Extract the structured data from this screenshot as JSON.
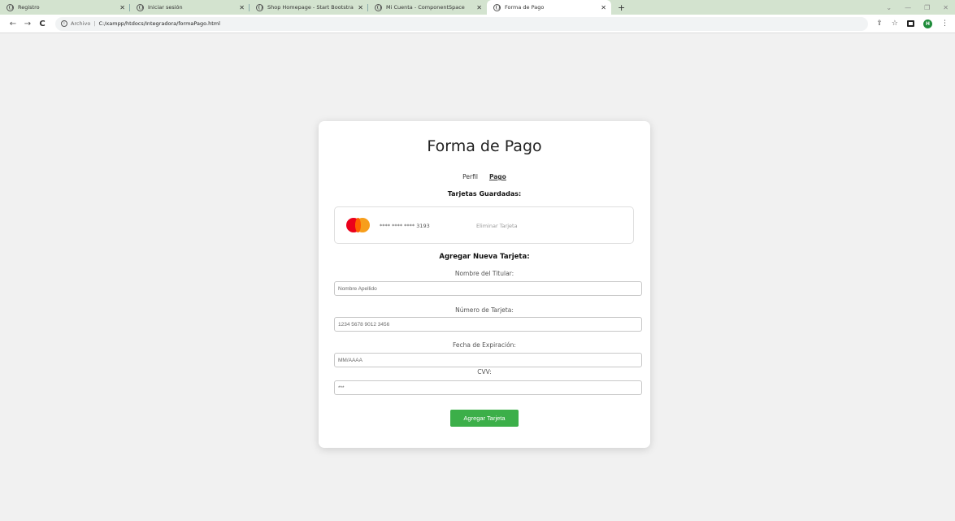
{
  "browser": {
    "tabs": [
      {
        "label": "Registro",
        "active": false
      },
      {
        "label": "Iniciar sesión",
        "active": false
      },
      {
        "label": "Shop Homepage - Start Bootstra",
        "active": false
      },
      {
        "label": "Mi Cuenta - ComponentSpace",
        "active": false
      },
      {
        "label": "Forma de Pago",
        "active": true
      }
    ],
    "new_tab": "+",
    "address": {
      "origin": "Archivo",
      "path": "C:/xampp/htdocs/Integradora/formaPago.html"
    },
    "profile_initial": "H"
  },
  "page": {
    "title": "Forma de Pago",
    "nav": {
      "profile": "Perfil",
      "payment": "Pago"
    },
    "saved_heading": "Tarjetas Guardadas:",
    "saved_card": {
      "number": "**** **** **** 3193",
      "remove": "Eliminar Tarjeta",
      "brand_icon": "mastercard-icon"
    },
    "add_heading": "Agregar Nueva Tarjeta:",
    "fields": {
      "holder": {
        "label": "Nombre del Titular:",
        "placeholder": "Nombre Apellido"
      },
      "number": {
        "label": "Número de Tarjeta:",
        "placeholder": "1234 5678 9012 3456"
      },
      "expiry": {
        "label": "Fecha de Expiración:",
        "placeholder": "MM/AAAA"
      },
      "cvv": {
        "label": "CVV:",
        "placeholder": "***"
      }
    },
    "submit": "Agregar Tarjeta"
  },
  "colors": {
    "accent": "#3caf49",
    "background": "#f1f1f1",
    "tabstrip": "#d3e3cf"
  }
}
